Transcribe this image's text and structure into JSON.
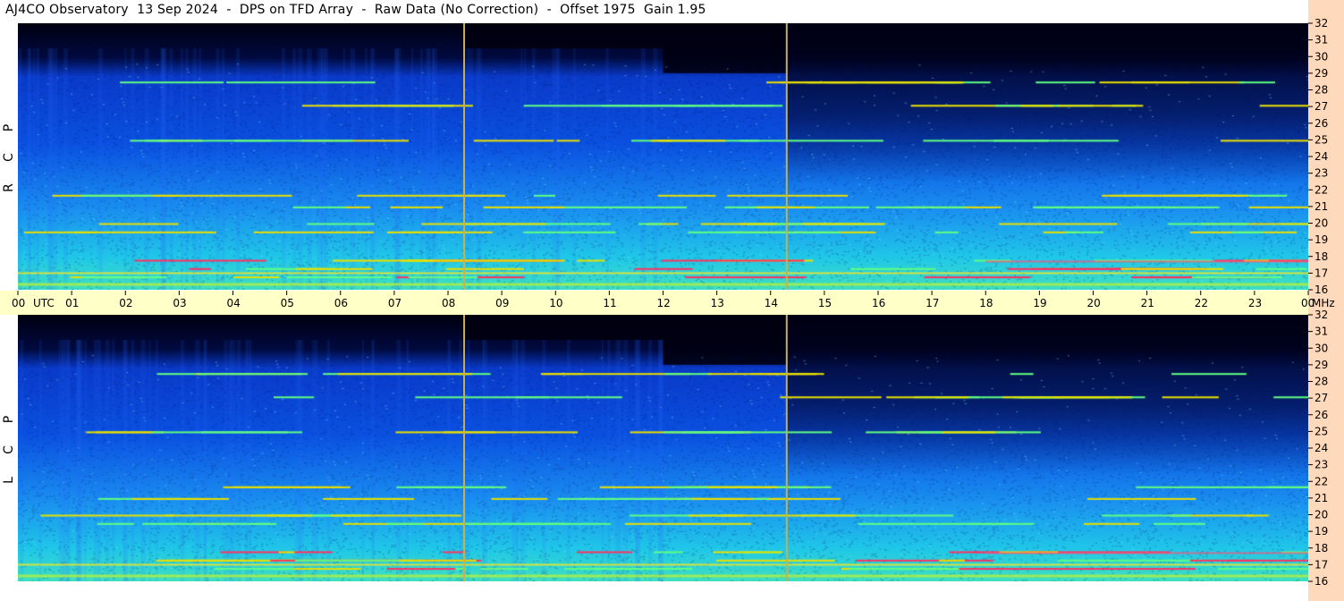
{
  "title": "AJ4CO Observatory  13 Sep 2024  -  DPS on TFD Array  -  Raw Data (No Correction)  -  Offset 1975  Gain 1.95",
  "panels": [
    {
      "label_letters": [
        "P",
        "C",
        "R"
      ]
    },
    {
      "label_letters": [
        "P",
        "C",
        "L"
      ]
    }
  ],
  "time_axis": {
    "labels": [
      "00",
      "01",
      "02",
      "03",
      "04",
      "05",
      "06",
      "07",
      "08",
      "09",
      "10",
      "11",
      "12",
      "13",
      "14",
      "15",
      "16",
      "17",
      "18",
      "19",
      "20",
      "21",
      "22",
      "23",
      "00"
    ],
    "utc_label": "UTC",
    "unit_label": "MHz"
  },
  "colors": {
    "background_dark": "#00001a",
    "band_blue": "#0a3ad8",
    "noise_cyan": "#19c8e8",
    "interference_yellow": "#e8e000",
    "time_bar": "#ffffc8",
    "freq_bar": "#ffd9bb",
    "marker_line": "#c8b050"
  },
  "chart_data": [
    {
      "type": "heatmap",
      "title": "AJ4CO Observatory  13 Sep 2024  -  DPS on TFD Array  -  Raw Data (No Correction)  -  Offset 1975  Gain 1.95",
      "polarization_label": "R C P",
      "x_unit": "UTC",
      "x_range": [
        0,
        24
      ],
      "y_unit": "MHz",
      "y_range": [
        16,
        32
      ],
      "y_ticks": [
        16,
        17,
        18,
        19,
        20,
        21,
        22,
        23,
        24,
        25,
        26,
        27,
        28,
        29,
        30,
        31,
        32
      ],
      "markers_utc": [
        8.3,
        14.3
      ],
      "strong_interference_mhz": [
        16.8,
        17.3,
        17.8,
        19.5,
        20.0,
        21.0,
        21.7,
        25.0,
        27.1,
        28.5
      ],
      "colorscale": [
        "black",
        "blue",
        "cyan",
        "yellow",
        "red"
      ]
    },
    {
      "type": "heatmap",
      "polarization_label": "L C P",
      "x_unit": "UTC",
      "x_range": [
        0,
        24
      ],
      "y_unit": "MHz",
      "y_range": [
        16,
        32
      ],
      "y_ticks": [
        16,
        17,
        18,
        19,
        20,
        21,
        22,
        23,
        24,
        25,
        26,
        27,
        28,
        29,
        30,
        31,
        32
      ],
      "markers_utc": [
        8.3,
        14.3
      ],
      "strong_interference_mhz": [
        16.8,
        17.3,
        17.8,
        19.5,
        20.0,
        21.0,
        21.7,
        25.0,
        27.1,
        28.5
      ],
      "colorscale": [
        "black",
        "blue",
        "cyan",
        "yellow",
        "red"
      ]
    }
  ]
}
